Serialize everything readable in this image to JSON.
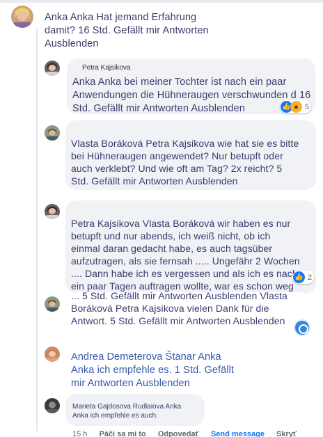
{
  "comments": [
    {
      "id": "c1",
      "text": "Anka Anka Hat jemand Erfahrung damit? 16 Std. Gefällt mir Antworten Ausblenden"
    },
    {
      "id": "c2",
      "author": "Petra Kajsikova",
      "text": "Anka Anka bei meiner Tochter ist nach ein paar Anwendungen die Hühneraugen verschwunden d 16 Std. Gefällt mir Antworten Ausblenden",
      "reactions": {
        "count": "5"
      }
    },
    {
      "id": "c3",
      "text": "Vlasta Boráková Petra Kajsikova wie hat sie es bitte bei Hühneraugen angewendet? Nur betupft oder auch verklebt? Und wie oft am Tag? 2x reicht? 5 Std. Gefällt mir Antworten Ausblenden"
    },
    {
      "id": "c4",
      "text": "Petra Kajsikova Vlasta Boráková wir haben es nur betupft und nur abends, ich weiß nicht, ob ich einmal daran gedacht habe, es auch tagsüber aufzutragen, als sie fernsah ..... Ungefähr 2 Wochen .... Dann habe ich es vergessen und als ich es nach ein paar Tagen auftragen wollte, war es schon weg",
      "reactions": {
        "count": "2"
      }
    },
    {
      "id": "c5",
      "text": "... 5 Std. Gefällt mir Antworten Ausblenden Vlasta Boráková Petra Kajsikova vielen Dank für die Antwort. 5 Std. Gefällt mir Antworten Ausblenden"
    },
    {
      "id": "c6",
      "text": "Andrea Demeterova Štanar Anka Anka ich empfehle es. 1 Std. Gefällt mir Antworten Ausblenden"
    },
    {
      "id": "c7",
      "text": "Marieta Gajdosova Rudlaiova Anka Anka ich empfehle es auch."
    }
  ],
  "footer": {
    "time": "15 h",
    "like": "Páči sa mi to",
    "reply": "Odpovedať",
    "message": "Send message",
    "hide": "Skryť"
  },
  "colors": {
    "bubble": "#f0f2f5",
    "text": "#3a3b6e",
    "link": "#3459a8",
    "like_blue": "#1877f2",
    "wow_yellow": "#f7b125"
  }
}
